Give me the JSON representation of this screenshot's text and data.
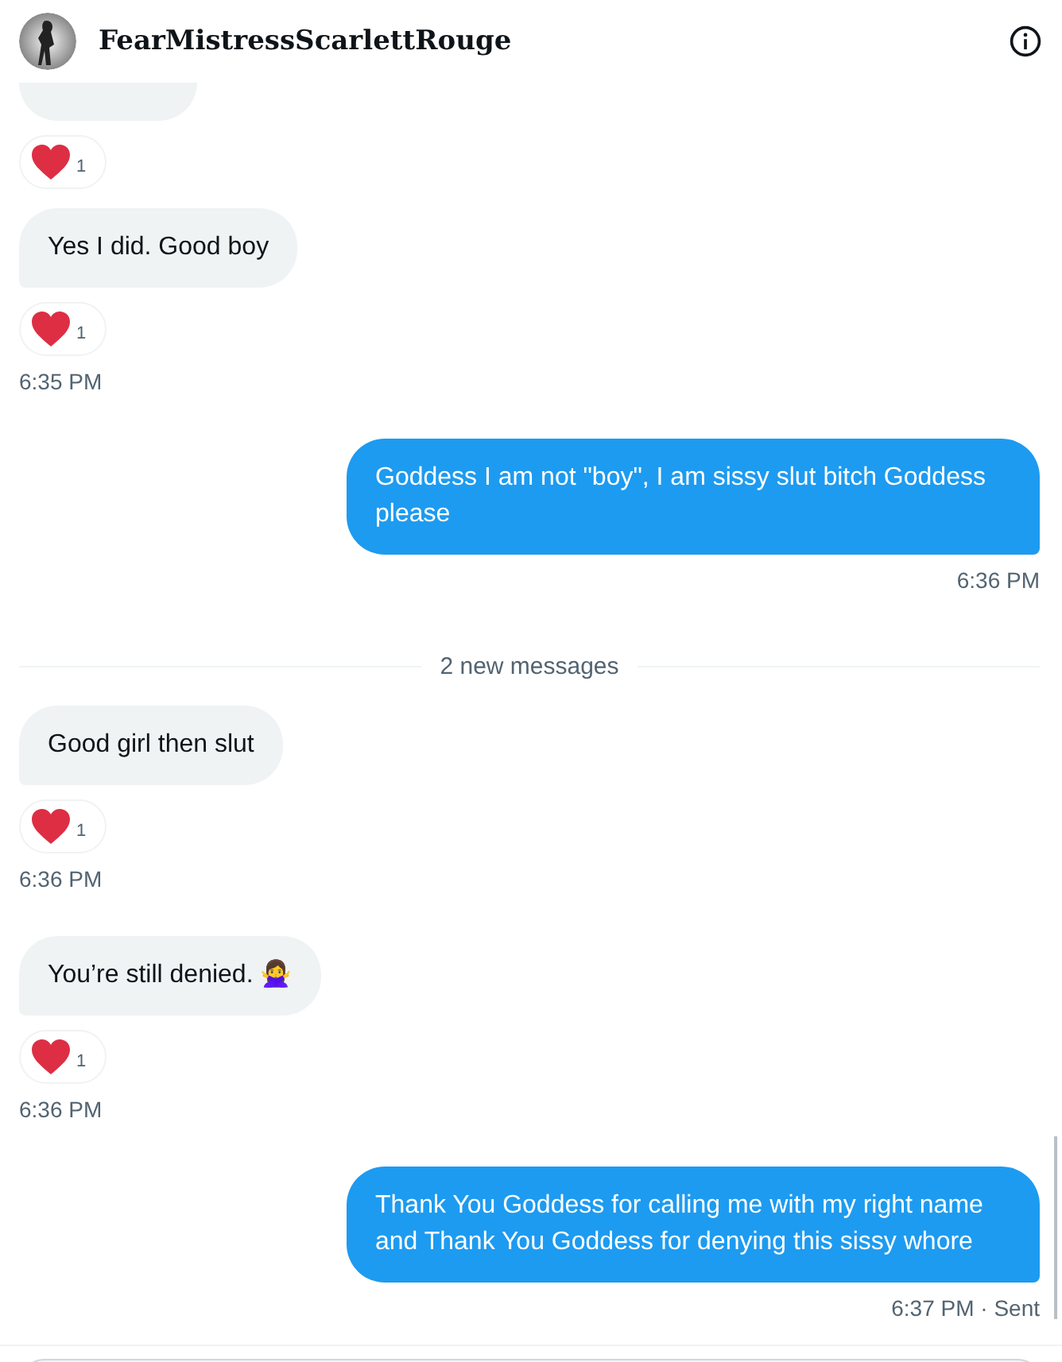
{
  "header": {
    "name": "FearMistressScarlettRouge"
  },
  "messages": [
    {
      "kind": "received",
      "reaction": "1"
    },
    {
      "kind": "received",
      "text": "Yes I did. Good boy",
      "reaction": "1",
      "time": "6:35 PM"
    },
    {
      "kind": "sent",
      "text": "Goddess I am not \"boy\", I am sissy slut bitch Goddess please",
      "time": "6:36 PM"
    },
    {
      "kind": "divider",
      "text": "2 new messages"
    },
    {
      "kind": "received",
      "text": "Good girl then slut",
      "reaction": "1",
      "time": "6:36 PM"
    },
    {
      "kind": "received",
      "text": "You’re still denied. 🙅‍♀️",
      "reaction": "1",
      "time": "6:36 PM"
    },
    {
      "kind": "sent",
      "text": "Thank You Goddess for calling me with my right name and Thank You Goddess for denying this sissy whore",
      "time": "6:37 PM · Sent"
    }
  ]
}
